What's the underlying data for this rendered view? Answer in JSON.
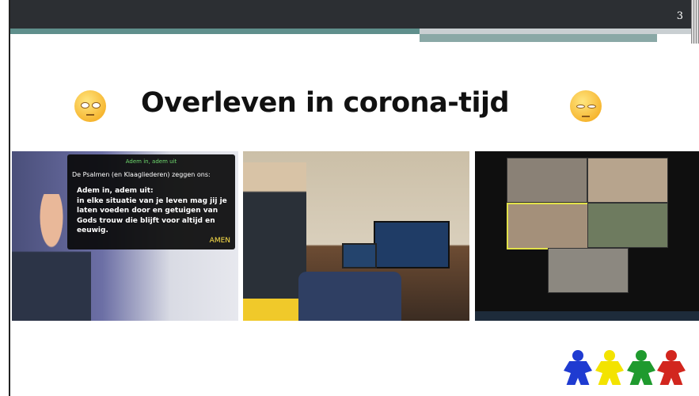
{
  "slide": {
    "page_number": "3",
    "title": "Overleven in corona-tijd"
  },
  "icons": {
    "left_emoji": "rolling-eyes-face-icon",
    "right_emoji": "sad-relieved-face-icon",
    "logo": "four-people-logo"
  },
  "colors": {
    "top_bar": "#2c2f33",
    "accent_teal": "#5f8f8c",
    "logo_blue": "#1f3bd1",
    "logo_yellow": "#f3e300",
    "logo_green": "#1f9a2e",
    "logo_red": "#d2261e"
  },
  "photos": {
    "photo1": {
      "overlay_heading": "Adem in, adem uit",
      "overlay_intro": "De Psalmen (en Klaagliederen) zeggen ons:",
      "overlay_body_line1": "Adem in, adem uit:",
      "overlay_body_line2": "in elke situatie van je leven mag jij je",
      "overlay_body_line3": "laten voeden door en getuigen van",
      "overlay_body_line4": "Gods trouw die blijft voor altijd en",
      "overlay_body_line5": "eeuwig.",
      "overlay_amen": "AMEN"
    }
  }
}
